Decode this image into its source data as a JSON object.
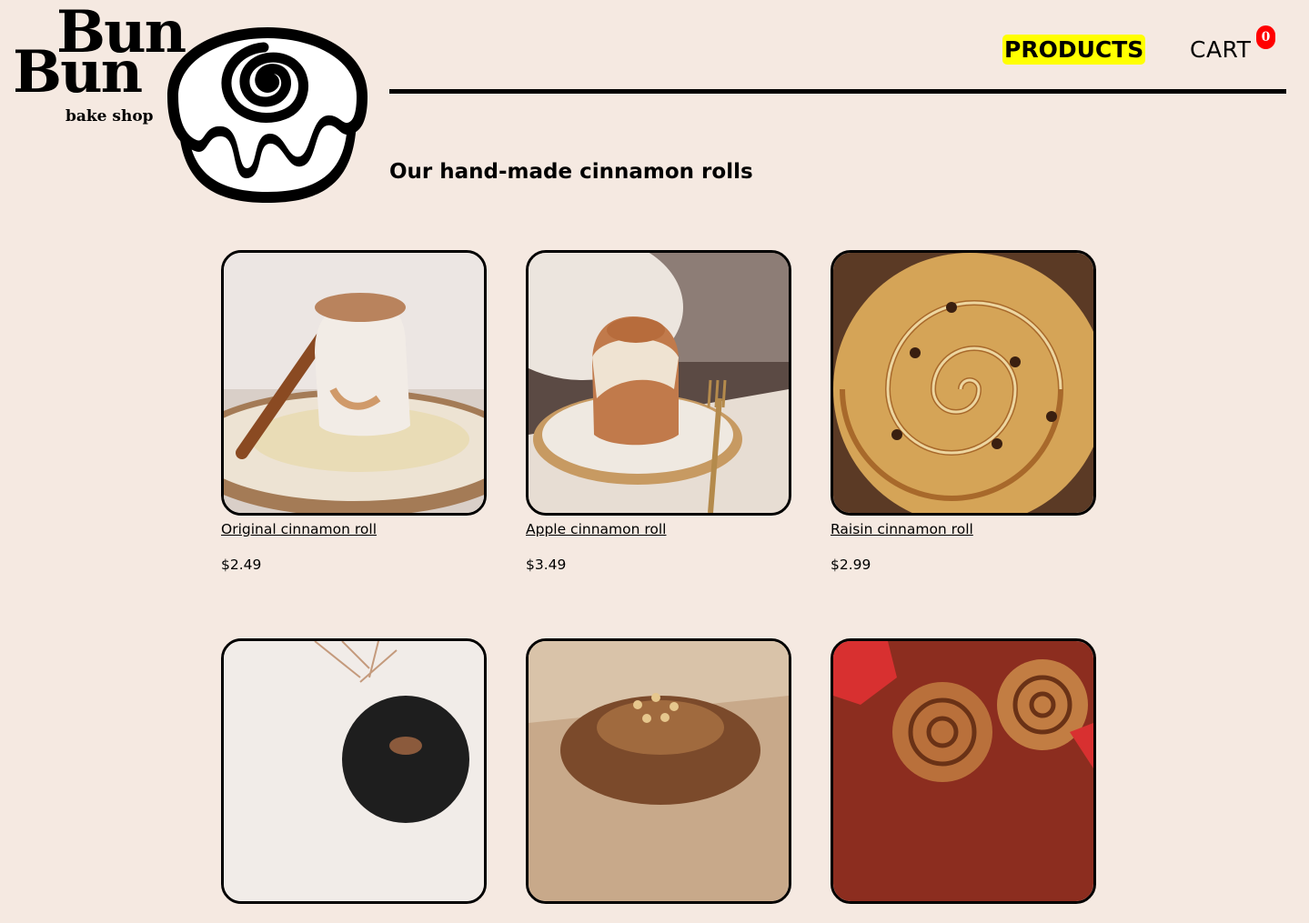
{
  "brand": {
    "line1": "Bun",
    "line2": "Bun",
    "tagline": "bake shop"
  },
  "nav": {
    "products_label": "PRODUCTS",
    "cart_label": "CART",
    "cart_count": "0"
  },
  "heading": "Our hand-made cinnamon rolls",
  "products": [
    {
      "name": "Original cinnamon roll",
      "price": "$2.49"
    },
    {
      "name": "Apple cinnamon roll",
      "price": "$3.49"
    },
    {
      "name": "Raisin cinnamon roll",
      "price": "$2.99"
    },
    {
      "name": "",
      "price": ""
    },
    {
      "name": "",
      "price": ""
    },
    {
      "name": "",
      "price": ""
    }
  ],
  "colors": {
    "background": "#f5e9e1",
    "highlight": "#ffff00",
    "badge": "#ff0000"
  }
}
